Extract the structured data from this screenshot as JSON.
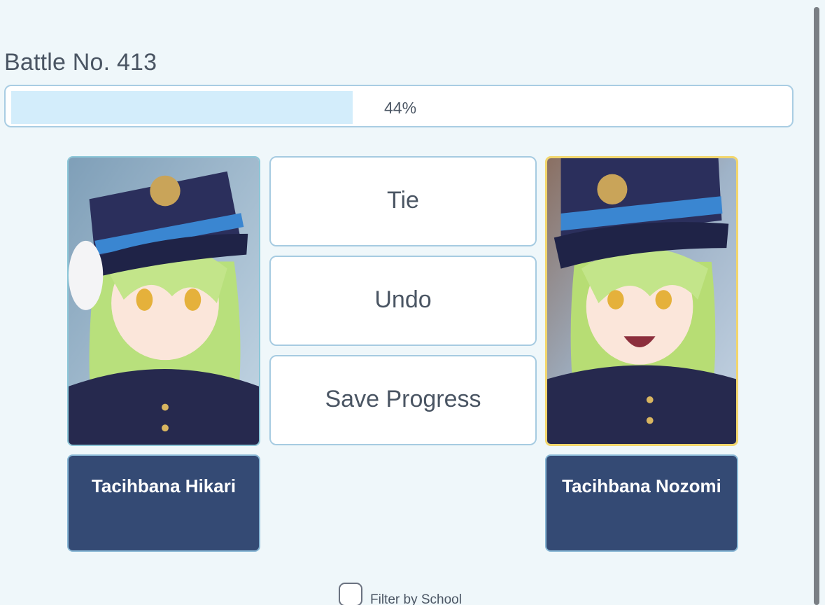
{
  "battle": {
    "title": "Battle No. 413"
  },
  "progress": {
    "percent_label": "44%",
    "value": 0.44
  },
  "left_card": {
    "name": "Tacihbana Hikari",
    "image_icon": "character-portrait-icon"
  },
  "right_card": {
    "name": "Tacihbana Nozomi",
    "image_icon": "character-portrait-icon"
  },
  "actions": {
    "tie_label": "Tie",
    "undo_label": "Undo",
    "save_label": "Save Progress"
  },
  "filter": {
    "label": "Filter by School",
    "checked": false
  },
  "colors": {
    "background": "#eff7fa",
    "progress_fill": "#d3edfb",
    "name_button": "#344a74",
    "highlight_border": "#f2d66d"
  }
}
